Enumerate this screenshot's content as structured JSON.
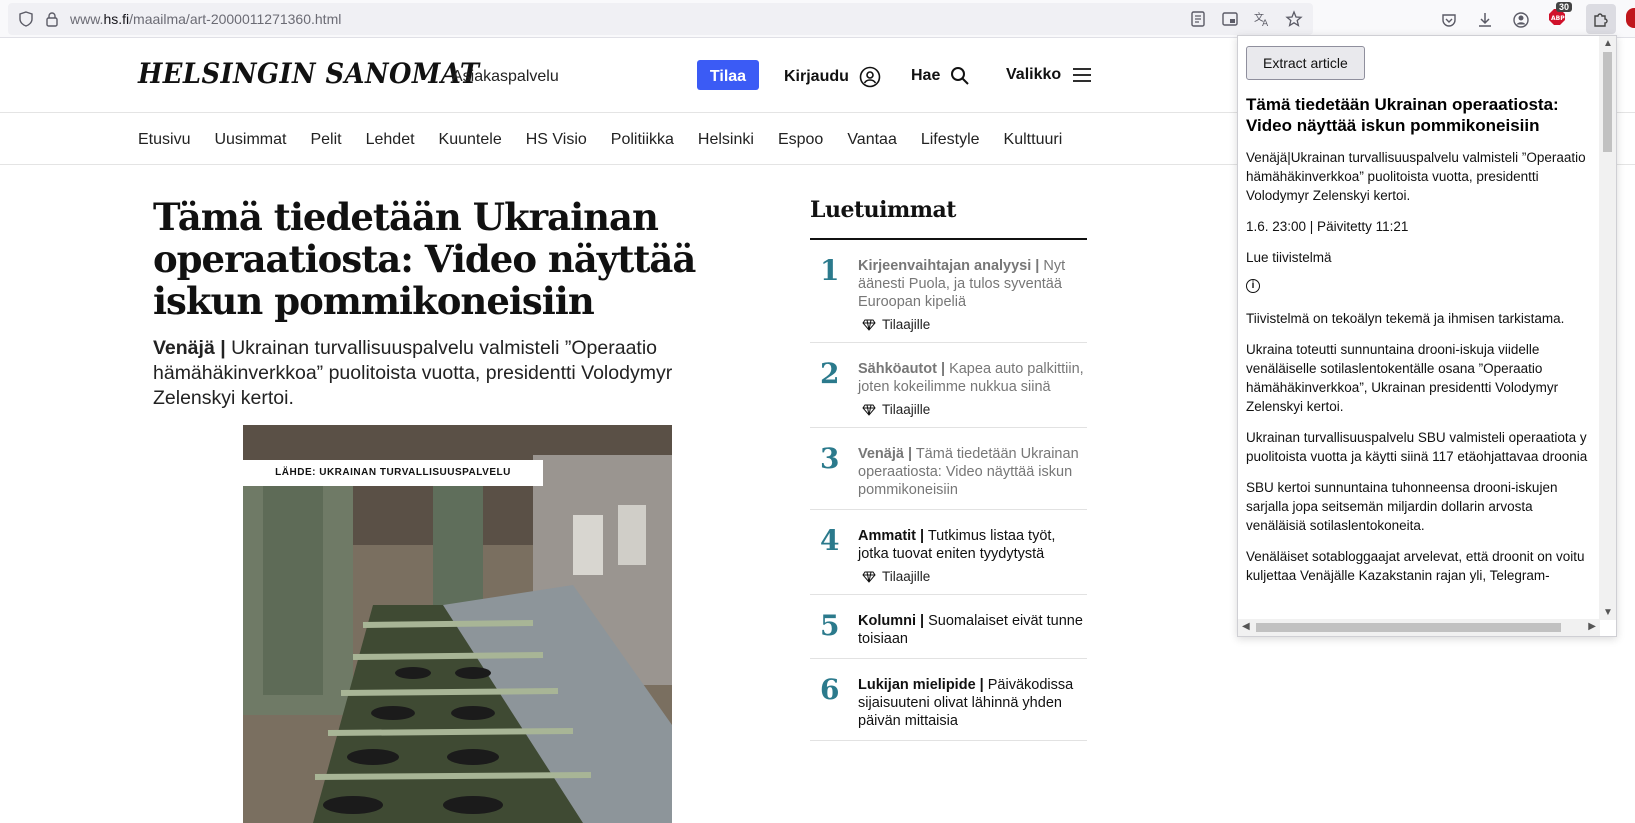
{
  "browser": {
    "url_prefix": "www.",
    "url_domain": "hs.fi",
    "url_path": "/maailma/art-2000011271360.html",
    "abp_badge": "30"
  },
  "site": {
    "logo": "HELSINGIN SANOMAT",
    "customer_service": "Asiakaspalvelu",
    "subscribe": "Tilaa",
    "login": "Kirjaudu",
    "search": "Hae",
    "menu": "Valikko",
    "nav": [
      "Etusivu",
      "Uusimmat",
      "Pelit",
      "Lehdet",
      "Kuuntele",
      "HS Visio",
      "Politiikka",
      "Helsinki",
      "Espoo",
      "Vantaa",
      "Lifestyle",
      "Kulttuuri"
    ]
  },
  "article": {
    "headline": "Tämä tiedetään Ukrainan operaatiosta: Video näyttää iskun pommikoneisiin",
    "kicker": "Venäjä |",
    "lead": " Ukrainan turvallisuuspalvelu valmisteli ”Operaatio hämähäkinverkkoa” puolitoista vuotta, presidentti Volodymyr Zelenskyi kertoi.",
    "image_source": "LÄHDE: UKRAINAN TURVALLISUUSPALVELU"
  },
  "most_read": {
    "title": "Luetuimmat",
    "items": [
      {
        "num": "1",
        "kicker": "Kirjeenvaihtajan analyysi |",
        "text": " Nyt äänesti Puola, ja tulos syventää Euroopan kipeliä",
        "badge": "Tilaajille"
      },
      {
        "num": "2",
        "kicker": "Sähköautot |",
        "text": " Kapea auto palkittiin, joten kokeilimme nukkua siinä",
        "badge": "Tilaajille"
      },
      {
        "num": "3",
        "kicker": "Venäjä |",
        "text": " Tämä tiedetään Ukrainan operaatiosta: Video näyttää iskun pommikoneisiin",
        "badge": ""
      },
      {
        "num": "4",
        "kicker": "Ammatit |",
        "text": " Tutkimus listaa työt, jotka tuovat eniten tyydytystä",
        "badge": "Tilaajille"
      },
      {
        "num": "5",
        "kicker": "Kolumni |",
        "text": " Suomalaiset eivät tunne toisiaan",
        "badge": ""
      },
      {
        "num": "6",
        "kicker": "Lukijan mielipide |",
        "text": " Päiväkodissa sijaisuuteni olivat lähinnä yhden päivän mittaisia",
        "badge": ""
      }
    ]
  },
  "popup": {
    "extract_button": "Extract article",
    "title": "Tämä tiedetään Ukrainan operaatiosta: Video näyttää iskun pommikoneisiin",
    "p1": "Venäjä|Ukrainan turvallisuuspalvelu valmisteli ”Operaatio hämähäkinverkkoa” puolitoista vuotta, presidentti Volodymyr Zelenskyi kertoi.",
    "date": "1.6. 23:00 | Päivitetty 11:21",
    "summary_link": "Lue tiivistelmä",
    "p_ai": "Tiivistelmä on tekoälyn tekemä ja ihmisen tarkistama.",
    "p2": "Ukraina toteutti sunnuntaina drooni-iskuja viidelle venäläiselle sotilaslentokentälle osana ”Operaatio hämähäkinverkkoa”, Ukrainan presidentti Volodymyr Zelenskyi kertoi.",
    "p3": "Ukrainan turvallisuuspalvelu SBU valmisteli operaatiota y puolitoista vuotta ja käytti siinä 117 etäohjattavaa droonia",
    "p4": "SBU kertoi sunnuntaina tuhonneensa drooni-iskujen sarjalla jopa seitsemän miljardin dollarin arvosta venäläisiä sotilaslentokoneita.",
    "p5": "Venäläiset sotabloggaajat arvelevat, että droonit on voitu kuljettaa Venäjälle Kazakstanin rajan yli, Telegram-"
  }
}
